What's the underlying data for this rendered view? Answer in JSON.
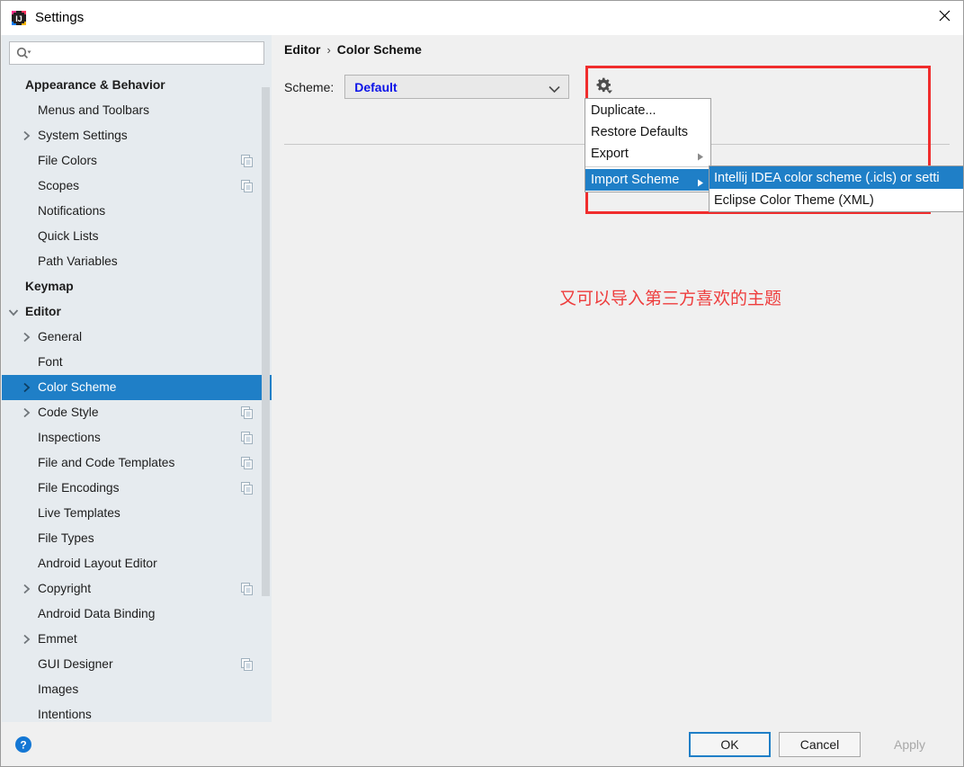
{
  "window": {
    "title": "Settings",
    "logo_icon": "intellij-idea-logo",
    "close_icon": "close-icon"
  },
  "search": {
    "placeholder": "",
    "value": "",
    "icon": "search-icon"
  },
  "sidebar": {
    "scrollbar": "vertical-scrollbar",
    "items": [
      {
        "label": "Appearance & Behavior",
        "bold": true,
        "indent": 0,
        "chevron": "none",
        "copy": false,
        "selected": false
      },
      {
        "label": "Menus and Toolbars",
        "bold": false,
        "indent": 1,
        "chevron": "none",
        "copy": false,
        "selected": false
      },
      {
        "label": "System Settings",
        "bold": false,
        "indent": 1,
        "chevron": "right",
        "copy": false,
        "selected": false
      },
      {
        "label": "File Colors",
        "bold": false,
        "indent": 1,
        "chevron": "none",
        "copy": true,
        "selected": false
      },
      {
        "label": "Scopes",
        "bold": false,
        "indent": 1,
        "chevron": "none",
        "copy": true,
        "selected": false
      },
      {
        "label": "Notifications",
        "bold": false,
        "indent": 1,
        "chevron": "none",
        "copy": false,
        "selected": false
      },
      {
        "label": "Quick Lists",
        "bold": false,
        "indent": 1,
        "chevron": "none",
        "copy": false,
        "selected": false
      },
      {
        "label": "Path Variables",
        "bold": false,
        "indent": 1,
        "chevron": "none",
        "copy": false,
        "selected": false
      },
      {
        "label": "Keymap",
        "bold": true,
        "indent": 0,
        "chevron": "none",
        "copy": false,
        "selected": false
      },
      {
        "label": "Editor",
        "bold": true,
        "indent": 0,
        "chevron": "down",
        "copy": false,
        "selected": false
      },
      {
        "label": "General",
        "bold": false,
        "indent": 1,
        "chevron": "right",
        "copy": false,
        "selected": false
      },
      {
        "label": "Font",
        "bold": false,
        "indent": 1,
        "chevron": "none",
        "copy": false,
        "selected": false
      },
      {
        "label": "Color Scheme",
        "bold": false,
        "indent": 1,
        "chevron": "right",
        "copy": false,
        "selected": true
      },
      {
        "label": "Code Style",
        "bold": false,
        "indent": 1,
        "chevron": "right",
        "copy": true,
        "selected": false
      },
      {
        "label": "Inspections",
        "bold": false,
        "indent": 1,
        "chevron": "none",
        "copy": true,
        "selected": false
      },
      {
        "label": "File and Code Templates",
        "bold": false,
        "indent": 1,
        "chevron": "none",
        "copy": true,
        "selected": false
      },
      {
        "label": "File Encodings",
        "bold": false,
        "indent": 1,
        "chevron": "none",
        "copy": true,
        "selected": false
      },
      {
        "label": "Live Templates",
        "bold": false,
        "indent": 1,
        "chevron": "none",
        "copy": false,
        "selected": false
      },
      {
        "label": "File Types",
        "bold": false,
        "indent": 1,
        "chevron": "none",
        "copy": false,
        "selected": false
      },
      {
        "label": "Android Layout Editor",
        "bold": false,
        "indent": 1,
        "chevron": "none",
        "copy": false,
        "selected": false
      },
      {
        "label": "Copyright",
        "bold": false,
        "indent": 1,
        "chevron": "right",
        "copy": true,
        "selected": false
      },
      {
        "label": "Android Data Binding",
        "bold": false,
        "indent": 1,
        "chevron": "none",
        "copy": false,
        "selected": false
      },
      {
        "label": "Emmet",
        "bold": false,
        "indent": 1,
        "chevron": "right",
        "copy": false,
        "selected": false
      },
      {
        "label": "GUI Designer",
        "bold": false,
        "indent": 1,
        "chevron": "none",
        "copy": true,
        "selected": false
      },
      {
        "label": "Images",
        "bold": false,
        "indent": 1,
        "chevron": "none",
        "copy": false,
        "selected": false
      },
      {
        "label": "Intentions",
        "bold": false,
        "indent": 1,
        "chevron": "none",
        "copy": false,
        "selected": false
      }
    ]
  },
  "content": {
    "breadcrumb": {
      "root": "Editor",
      "separator": "›",
      "current": "Color Scheme"
    },
    "scheme": {
      "label": "Scheme:",
      "value": "Default",
      "dropdown_icon": "chevron-down-icon"
    },
    "annotation": "又可以导入第三方喜欢的主题"
  },
  "gear_menu": {
    "button_icon": "gear-icon",
    "items": [
      {
        "label": "Duplicate...",
        "arrow": false,
        "highlighted": false
      },
      {
        "label": "Restore Defaults",
        "arrow": false,
        "highlighted": false
      },
      {
        "label": "Export",
        "arrow": true,
        "highlighted": false
      },
      {
        "label": "Import Scheme",
        "arrow": true,
        "highlighted": true
      }
    ],
    "submenu": [
      {
        "label": "Intellij IDEA color scheme (.icls) or setti",
        "highlighted": true
      },
      {
        "label": "Eclipse Color Theme (XML)",
        "highlighted": false
      }
    ]
  },
  "footer": {
    "help_icon": "help-icon",
    "ok_label": "OK",
    "cancel_label": "Cancel",
    "apply_label": "Apply"
  },
  "colors": {
    "accent_blue": "#1f7fc7",
    "sidebar_bg": "#e6ebef",
    "content_bg": "#f0f0f0",
    "highlight_red": "#f02d2d",
    "scheme_value_blue": "#0b12e8"
  }
}
